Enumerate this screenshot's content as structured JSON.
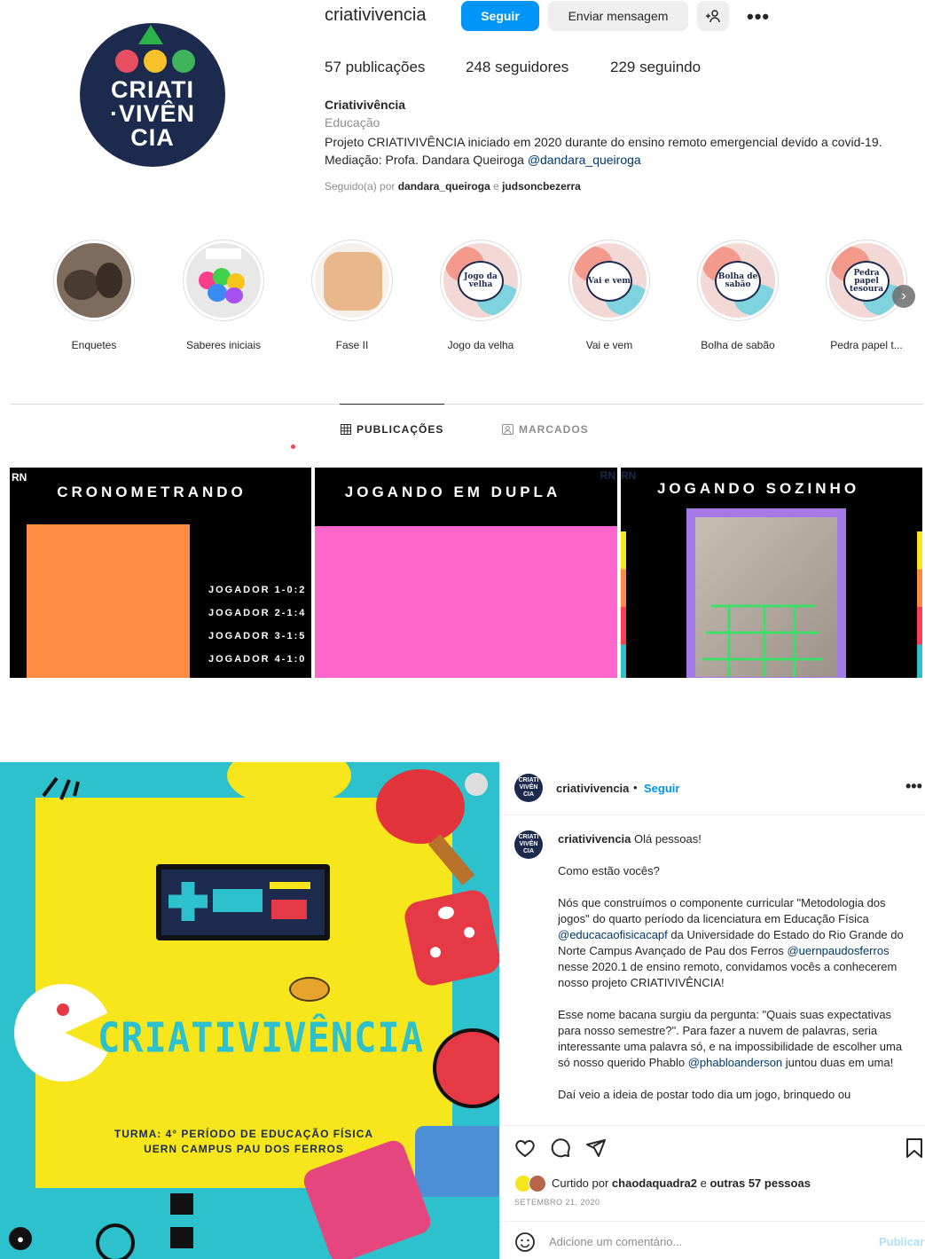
{
  "profile": {
    "username": "criativivencia",
    "follow_label": "Seguir",
    "message_label": "Enviar mensagem",
    "add_user_label": "+♀",
    "more_label": "•••",
    "avatar_text": "CRIATI\nVIVÊN\nCIA",
    "stats": {
      "posts": "57 publicações",
      "followers": "248 seguidores",
      "following": "229 seguindo"
    },
    "full_name": "Criativivência",
    "category": "Educação",
    "bio_text": "Projeto CRIATIVIVÊNCIA iniciado em 2020 durante do ensino remoto emergencial devido a covid-19. Mediação: Profa. Dandara Queiroga ",
    "bio_link": "@dandara_queiroga",
    "followed_prefix": "Seguido(a) por ",
    "followed_user1": "dandara_queiroga",
    "followed_and": " e ",
    "followed_user2": "judsoncbezerra"
  },
  "highlights": [
    {
      "label": "Enquetes",
      "inner": ""
    },
    {
      "label": "Saberes iniciais",
      "inner": ""
    },
    {
      "label": "Fase II",
      "inner": ""
    },
    {
      "label": "Jogo da velha",
      "inner": "Jogo da velha"
    },
    {
      "label": "Vai e vem",
      "inner": "Vai e vem"
    },
    {
      "label": "Bolha de sabão",
      "inner": "Bolha de sabão"
    },
    {
      "label": "Pedra papel t...",
      "inner": "Pedra papel tesoura"
    }
  ],
  "tabs": {
    "posts": "PUBLICAÇÕES",
    "tagged": "MARCADOS"
  },
  "grid": [
    {
      "title": "CRONOMETRANDO",
      "lines": [
        "JOGADOR 1-0:2",
        "JOGADOR 2-1:4",
        "JOGADOR 3-1:5",
        "JOGADOR 4-1:0"
      ]
    },
    {
      "title": "JOGANDO EM DUPLA"
    },
    {
      "title": "JOGANDO SOZINHO"
    }
  ],
  "grid_corner": "RN",
  "banner": {
    "title": "CRIATIVIVÊNCIA",
    "line1": "TURMA: 4° PERÍODO DE EDUCAÇÃO FÍSICA",
    "line2": "UERN CAMPUS PAU DOS FERROS"
  },
  "post": {
    "username": "criativivencia",
    "separator": "•",
    "follow_label": "Seguir",
    "more_label": "•••",
    "caption_intro": " Olá pessoas!",
    "p1": "Como estão vocês?",
    "p2_a": "Nós que construímos o componente curricular \"Metodologia dos jogos\" do quarto período da licenciatura em Educação Física ",
    "p2_link1": "@educacaofisicacapf",
    "p2_b": " da Universidade do Estado do Rio Grande do Norte Campus Avançado de Pau dos Ferros ",
    "p2_link2": "@uernpaudosferros",
    "p2_c": " nesse 2020.1 de ensino remoto, convidamos vocês a conhecerem nosso projeto CRIATIVIVÊNCIA!",
    "p3_a": "Esse nome bacana surgiu da pergunta: \"Quais suas expectativas para nosso semestre?\". Para fazer a nuvem de palavras, seria interessante uma palavra só, e na impossibilidade de escolher uma só nosso querido Phablo ",
    "p3_link": "@phabloanderson",
    "p3_b": " juntou duas em uma!",
    "p4": "Daí veio a ideia de postar todo dia um jogo, brinquedo ou",
    "likes_prefix": "Curtido por ",
    "likes_user": "chaodaquadra2",
    "likes_and": " e ",
    "likes_others": "outras 57 pessoas",
    "date": "SETEMBRO 21, 2020",
    "comment_placeholder": "Adicione um comentário...",
    "publish_label": "Publicar"
  },
  "colors": {
    "accent": "#0095f6",
    "banner_bg": "#2cc1cc",
    "banner_yellow": "#f6e61b",
    "navy": "#1c2a4e"
  }
}
